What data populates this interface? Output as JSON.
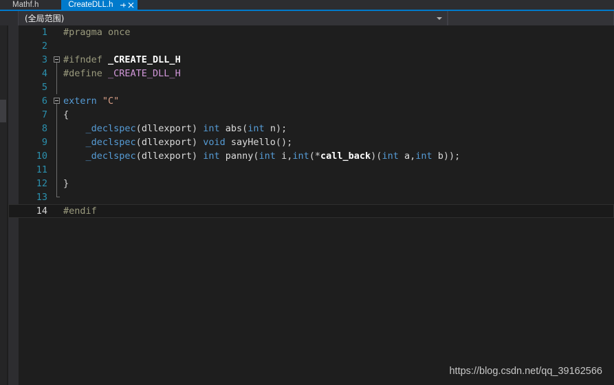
{
  "window": {
    "theme": "visual-studio-dark",
    "colors": {
      "background": "#1E1E1E",
      "chrome": "#2D2D30",
      "accent": "#007ACC",
      "line_number": "#2B91AF",
      "keyword": "#569CD6",
      "macro": "#D197D9",
      "preprocessor": "#9B9B7E",
      "string": "#D69D85",
      "text": "#D4D4D4"
    }
  },
  "tabs": [
    {
      "label": "Mathf.h",
      "active": false,
      "icon": ""
    },
    {
      "label": "CreateDLL.h",
      "active": true,
      "pin_icon": "pin-icon",
      "close_icon": "close-icon"
    }
  ],
  "nav_bar": {
    "scope_dropdown": {
      "value": "(全局范围)",
      "icon": "chevron-down-icon"
    },
    "member_dropdown": {
      "value": "",
      "icon": "chevron-down-icon"
    }
  },
  "editor": {
    "current_line": 14,
    "lines": [
      {
        "n": "1",
        "fold": "none",
        "tokens": [
          {
            "t": "#pragma once",
            "c": "tk-pp"
          }
        ]
      },
      {
        "n": "2",
        "fold": "none",
        "tokens": []
      },
      {
        "n": "3",
        "fold": "box",
        "tokens": [
          {
            "t": "#ifndef ",
            "c": "tk-pp"
          },
          {
            "t": "_CREATE_DLL_H",
            "c": "tk-macrodef"
          }
        ]
      },
      {
        "n": "4",
        "fold": "line",
        "tokens": [
          {
            "t": "#define ",
            "c": "tk-pp"
          },
          {
            "t": "_CREATE_DLL_H",
            "c": "tk-macro"
          }
        ]
      },
      {
        "n": "5",
        "fold": "line",
        "tokens": []
      },
      {
        "n": "6",
        "fold": "box",
        "tokens": [
          {
            "t": "extern",
            "c": "tk-kw"
          },
          {
            "t": " ",
            "c": "tk-punc"
          },
          {
            "t": "\"C\"",
            "c": "tk-str"
          }
        ]
      },
      {
        "n": "7",
        "fold": "line",
        "tokens": [
          {
            "t": "{",
            "c": "tk-punc"
          }
        ]
      },
      {
        "n": "8",
        "fold": "line",
        "tokens": [
          {
            "t": "    ",
            "c": "tk-punc"
          },
          {
            "t": "_declspec",
            "c": "tk-kw"
          },
          {
            "t": "(",
            "c": "tk-punc"
          },
          {
            "t": "dllexport",
            "c": "tk-id"
          },
          {
            "t": ") ",
            "c": "tk-punc"
          },
          {
            "t": "int",
            "c": "tk-kw"
          },
          {
            "t": " ",
            "c": "tk-punc"
          },
          {
            "t": "abs",
            "c": "tk-fn"
          },
          {
            "t": "(",
            "c": "tk-punc"
          },
          {
            "t": "int",
            "c": "tk-kw"
          },
          {
            "t": " ",
            "c": "tk-punc"
          },
          {
            "t": "n",
            "c": "tk-id"
          },
          {
            "t": ");",
            "c": "tk-punc"
          }
        ]
      },
      {
        "n": "9",
        "fold": "line",
        "tokens": [
          {
            "t": "    ",
            "c": "tk-punc"
          },
          {
            "t": "_declspec",
            "c": "tk-kw"
          },
          {
            "t": "(",
            "c": "tk-punc"
          },
          {
            "t": "dllexport",
            "c": "tk-id"
          },
          {
            "t": ") ",
            "c": "tk-punc"
          },
          {
            "t": "void",
            "c": "tk-kw"
          },
          {
            "t": " ",
            "c": "tk-punc"
          },
          {
            "t": "sayHello",
            "c": "tk-fn"
          },
          {
            "t": "();",
            "c": "tk-punc"
          }
        ]
      },
      {
        "n": "10",
        "fold": "line",
        "tokens": [
          {
            "t": "    ",
            "c": "tk-punc"
          },
          {
            "t": "_declspec",
            "c": "tk-kw"
          },
          {
            "t": "(",
            "c": "tk-punc"
          },
          {
            "t": "dllexport",
            "c": "tk-id"
          },
          {
            "t": ") ",
            "c": "tk-punc"
          },
          {
            "t": "int",
            "c": "tk-kw"
          },
          {
            "t": " ",
            "c": "tk-punc"
          },
          {
            "t": "panny",
            "c": "tk-fn"
          },
          {
            "t": "(",
            "c": "tk-punc"
          },
          {
            "t": "int",
            "c": "tk-kw"
          },
          {
            "t": " ",
            "c": "tk-punc"
          },
          {
            "t": "i",
            "c": "tk-id"
          },
          {
            "t": ",",
            "c": "tk-punc"
          },
          {
            "t": "int",
            "c": "tk-kw"
          },
          {
            "t": "(*",
            "c": "tk-punc"
          },
          {
            "t": "call_back",
            "c": "tk-fnptr"
          },
          {
            "t": ")(",
            "c": "tk-punc"
          },
          {
            "t": "int",
            "c": "tk-kw"
          },
          {
            "t": " ",
            "c": "tk-punc"
          },
          {
            "t": "a",
            "c": "tk-id"
          },
          {
            "t": ",",
            "c": "tk-punc"
          },
          {
            "t": "int",
            "c": "tk-kw"
          },
          {
            "t": " ",
            "c": "tk-punc"
          },
          {
            "t": "b",
            "c": "tk-id"
          },
          {
            "t": "));",
            "c": "tk-punc"
          }
        ]
      },
      {
        "n": "11",
        "fold": "line",
        "tokens": []
      },
      {
        "n": "12",
        "fold": "line",
        "tokens": [
          {
            "t": "}",
            "c": "tk-punc"
          }
        ]
      },
      {
        "n": "13",
        "fold": "end",
        "tokens": []
      },
      {
        "n": "14",
        "fold": "none",
        "tokens": [
          {
            "t": "#endif",
            "c": "tk-pp"
          }
        ]
      }
    ]
  },
  "watermark": {
    "text": "https://blog.csdn.net/qq_39162566"
  }
}
